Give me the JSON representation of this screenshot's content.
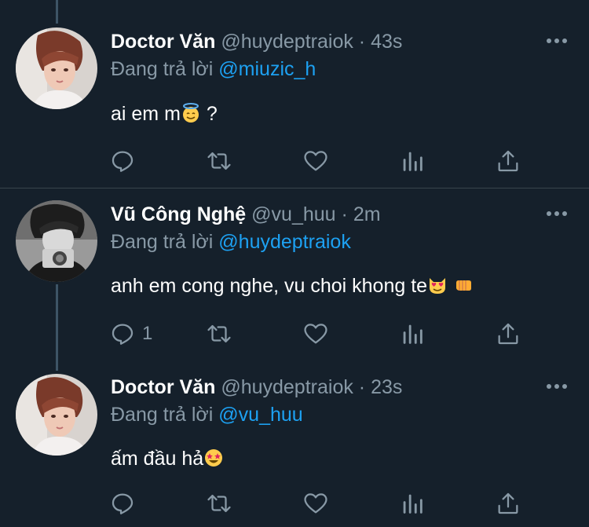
{
  "tweets": [
    {
      "name": "Doctor Văn",
      "handle": "@huydeptraiok",
      "dot": "·",
      "time": "43s",
      "replying_prefix": "Đang trả lời",
      "replying_to": "@miuzic_h",
      "text": "ai em m",
      "text_suffix": " ?",
      "emoji": "smiling-face-with-halo",
      "reply_count": "",
      "avatar": "avatar-photo"
    },
    {
      "name": "Vũ Công Nghệ",
      "handle": "@vu_huu",
      "dot": "·",
      "time": "2m",
      "replying_prefix": "Đang trả lời",
      "replying_to": "@huydeptraiok",
      "text": "anh em cong nghe, vu choi khong te",
      "emoji": "heart-eyes-cat",
      "emoji2": "left-facing-fist",
      "reply_count": "1",
      "avatar": "avatar-photo-bw"
    },
    {
      "name": "Doctor Văn",
      "handle": "@huydeptraiok",
      "dot": "·",
      "time": "23s",
      "replying_prefix": "Đang trả lời",
      "replying_to": "@vu_huu",
      "text": "ấm đầu hả",
      "emoji": "star-struck",
      "reply_count": "",
      "avatar": "avatar-photo"
    }
  ],
  "colors": {
    "background": "#15202b",
    "secondary_text": "#8899a6",
    "link": "#1da1f2",
    "divider": "#38444d"
  },
  "icons": {
    "reply": "reply-icon",
    "retweet": "retweet-icon",
    "like": "heart-icon",
    "analytics": "analytics-icon",
    "share": "share-icon",
    "more": "more-icon"
  }
}
